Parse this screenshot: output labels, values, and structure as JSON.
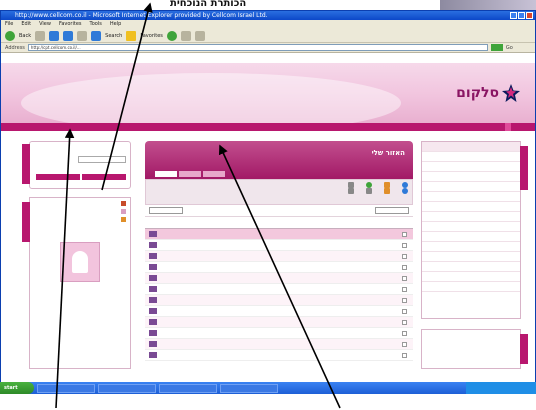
{
  "annotation": {
    "top_label": "הכותרת הנוכחית"
  },
  "window": {
    "title": "http://www.cellcom.co.il - Microsoft Internet Explorer provided by Cellcom Israel Ltd.",
    "menu": [
      "File",
      "Edit",
      "View",
      "Favorites",
      "Tools",
      "Help"
    ],
    "toolbar": {
      "back_label": "Back",
      "search_label": "Search",
      "favorites_label": "Favorites"
    },
    "address_label": "Address",
    "address_value": "http://cpt.cellcom.co.il/...",
    "go_label": "Go"
  },
  "site": {
    "logo_text": "סלקום"
  },
  "main": {
    "title": "האזור שלי"
  },
  "taskbar": {
    "start_label": "start",
    "items": [
      "",
      "",
      "",
      ""
    ]
  },
  "colors": {
    "brand": "#b8176e",
    "brand_light": "#f1c4de",
    "taskbar": "#1d5fd6",
    "start": "#3fa43a"
  },
  "icons": {
    "arrow": "arrow-icon",
    "logo": "cellcom-star-logo",
    "back": "back-icon",
    "search": "search-icon"
  }
}
